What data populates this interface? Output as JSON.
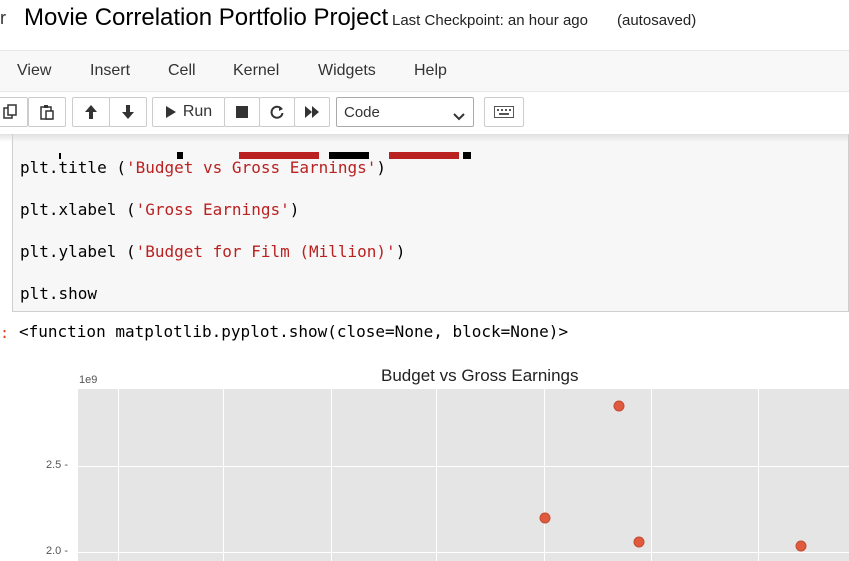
{
  "header": {
    "logo_fragment": "r",
    "notebook_title": "Movie Correlation Portfolio Project",
    "checkpoint": "Last Checkpoint: an hour ago",
    "autosave": "(autosaved)"
  },
  "menu": {
    "items": [
      {
        "label": "View"
      },
      {
        "label": "Insert"
      },
      {
        "label": "Cell"
      },
      {
        "label": "Kernel"
      },
      {
        "label": "Widgets"
      },
      {
        "label": "Help"
      }
    ]
  },
  "toolbar": {
    "run_label": "Run",
    "cell_type": "Code",
    "icons": [
      "copy-icon",
      "paste-icon",
      "arrow-up-icon",
      "arrow-down-icon",
      "run-icon",
      "stop-icon",
      "restart-icon",
      "fast-forward-icon",
      "chevron-down-icon",
      "keyboard-icon"
    ]
  },
  "code_cell": {
    "lines": [
      {
        "fn": "plt.title (",
        "str": "'Budget vs Gross Earnings'",
        "end": ")"
      },
      {
        "fn": "plt.xlabel (",
        "str": "'Gross Earnings'",
        "end": ")"
      },
      {
        "fn": "plt.ylabel (",
        "str": "'Budget for Film (Million)'",
        "end": ")"
      },
      {
        "fn": "plt.show",
        "str": "",
        "end": ""
      }
    ]
  },
  "output": {
    "prompt": ":",
    "text": "<function matplotlib.pyplot.show(close=None, block=None)>"
  },
  "chart_data": {
    "type": "scatter",
    "title": "Budget vs Gross Earnings",
    "y_exponent_label": "1e9",
    "y_ticks": [
      "2.5",
      "2.0"
    ],
    "ylim_visible": [
      1.95,
      2.95
    ],
    "grid": true,
    "points": [
      {
        "x": 0.702,
        "y": 2.85
      },
      {
        "x": 0.606,
        "y": 2.2
      },
      {
        "x": 0.727,
        "y": 2.06
      },
      {
        "x": 0.938,
        "y": 2.04
      }
    ],
    "colors": {
      "point": "#e05a3f",
      "background": "#e5e5e5",
      "grid": "#ffffff"
    }
  }
}
